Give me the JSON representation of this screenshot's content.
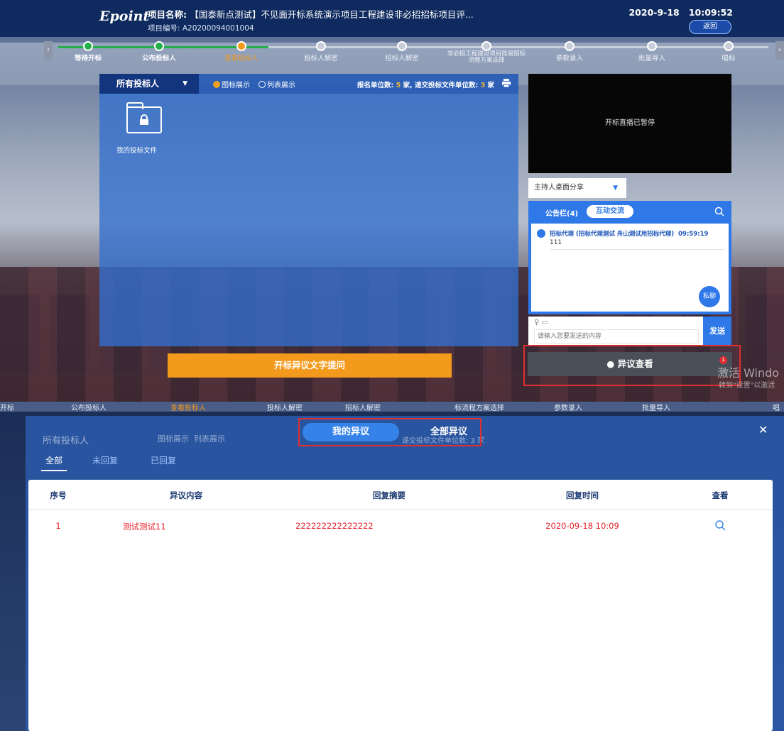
{
  "header": {
    "logo": "Epoint",
    "project_name_label": "项目名称:",
    "project_name_value": "【国泰新点测试】不见面开标系统演示项目工程建设非必招招标项目评...",
    "project_no": "项目编号:  A20200094001004",
    "date": "2020-9-18",
    "time": "10:09:52",
    "back_label": "返回"
  },
  "steps": [
    {
      "label": "等待开标",
      "state": "done"
    },
    {
      "label": "公布投标人",
      "state": "done"
    },
    {
      "label": "查看投标人",
      "state": "current"
    },
    {
      "label": "投标人解密",
      "state": "todo"
    },
    {
      "label": "招标人解密",
      "state": "todo"
    },
    {
      "label": "非必招工程建设项目简易招标流程方案选择",
      "state": "todo"
    },
    {
      "label": "参数录入",
      "state": "todo"
    },
    {
      "label": "批量导入",
      "state": "todo"
    },
    {
      "label": "唱标",
      "state": "todo"
    }
  ],
  "main": {
    "bidder_select": "所有投标人",
    "view_icon_label": "图标展示",
    "view_list_label": "列表展示",
    "count_prefix": "报名单位数: ",
    "registered_count": "5",
    "count_mid": " 家, 递交投标文件单位数: ",
    "submitted_count": "3",
    "count_suffix": " 家",
    "folder_label": "我的投标文件"
  },
  "side": {
    "live_status": "开标直播已暂停",
    "share_select": "主持人桌面分享",
    "notice_tab": "公告栏(4)",
    "exchange_tab": "互动交流",
    "message_sender": "招标代理 (招标代理测试 舟山测试用招标代理)",
    "message_time": "09:59:19",
    "message_text": "111",
    "private_chat": "私聊",
    "input_placeholder": "请输入您要发送的内容",
    "send_label": "发送"
  },
  "actions": {
    "objection_question": "开标异议文字提问",
    "view_objection": "异议查看",
    "view_objection_badge": "1"
  },
  "watermark": {
    "line1": "激活 Windo",
    "line2": "转到\"设置\"以激活"
  },
  "bottom": {
    "strip": [
      "开标",
      "公布投标人",
      "查看投标人",
      "投标人解密",
      "招标人解密",
      "标流程方案选择",
      "参数录入",
      "批量导入",
      "唱"
    ],
    "bg_select": "所有投标人",
    "bg_view_icon": "图标展示",
    "bg_view_list": "列表展示",
    "bg_count": "递交投标文件单位数: 3 家",
    "toggle_mine": "我的异议",
    "toggle_all": "全部异议",
    "tabs": [
      "全部",
      "未回复",
      "已回复"
    ],
    "columns": [
      "序号",
      "异议内容",
      "回复摘要",
      "回复时间",
      "查看"
    ],
    "rows": [
      {
        "no": "1",
        "content": "测试测试11",
        "summary": "222222222222222",
        "reply_time": "2020-09-18 10:09"
      }
    ]
  },
  "colors": {
    "primary_blue": "#2e78e8",
    "header_navy": "#0f2a5e",
    "orange": "#f39a1c",
    "step_done_green": "#23b04b",
    "highlight_red": "#e02f2f",
    "row_text_red": "#e8202a"
  },
  "icons": [
    "print-icon",
    "lock-icon",
    "search-icon",
    "mic-icon",
    "folder-icon",
    "chat-bubble-icon",
    "close-icon",
    "user-icon"
  ]
}
